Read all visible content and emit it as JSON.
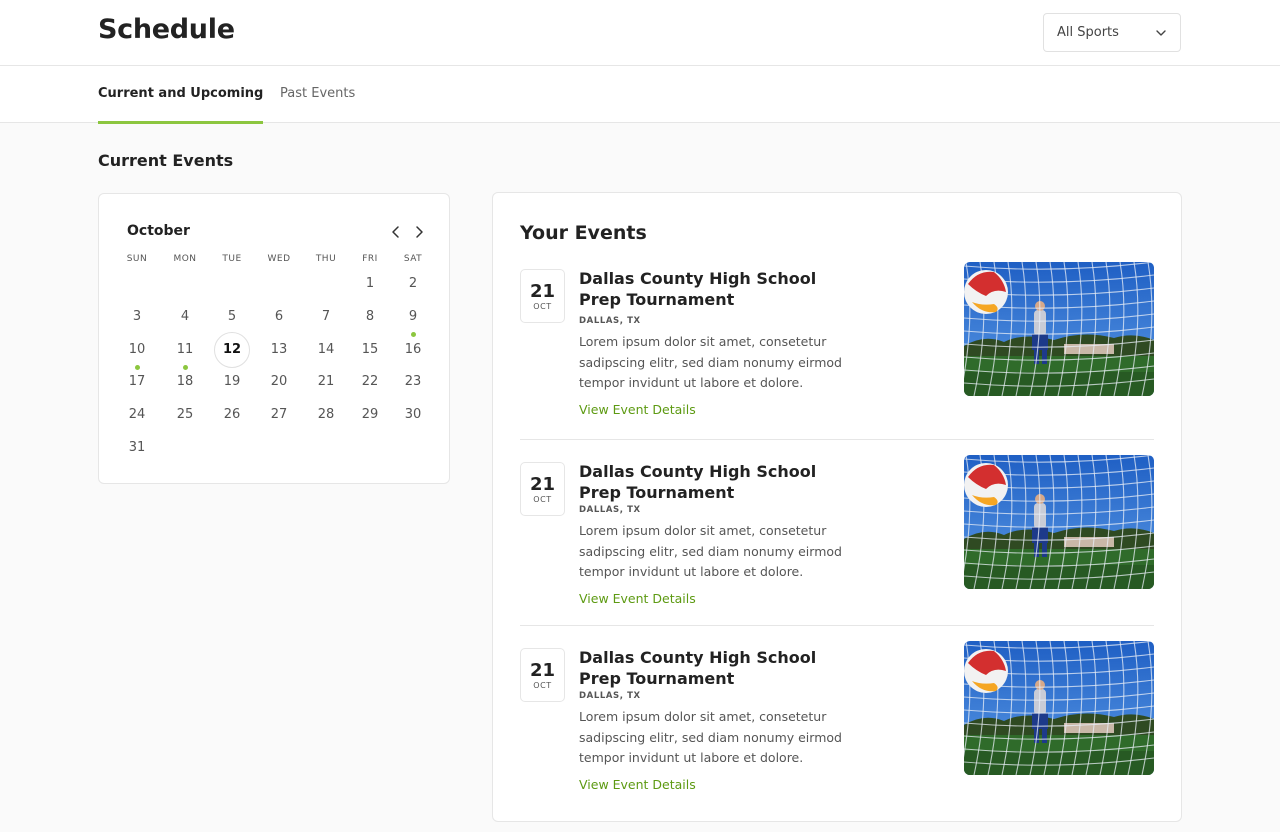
{
  "header": {
    "title": "Schedule",
    "sport_filter": {
      "selected": "All Sports"
    }
  },
  "tabs": [
    {
      "label": "Current and Upcoming",
      "active": true
    },
    {
      "label": "Past Events",
      "active": false
    }
  ],
  "section_title": "Current Events",
  "calendar": {
    "month": "October",
    "weekdays": [
      "SUN",
      "MON",
      "TUE",
      "WED",
      "THU",
      "FRI",
      "SAT"
    ],
    "days": [
      1,
      2,
      3,
      4,
      5,
      6,
      7,
      8,
      9,
      10,
      11,
      12,
      13,
      14,
      15,
      16,
      17,
      18,
      19,
      20,
      21,
      22,
      23,
      24,
      25,
      26,
      27,
      28,
      29,
      30,
      31
    ],
    "first_weekday_index": 5,
    "selected_day": 12,
    "event_days": [
      9,
      10,
      11
    ],
    "accent_color": "#8cc63f"
  },
  "events_panel": {
    "title": "Your Events",
    "events": [
      {
        "day": "21",
        "month": "OCT",
        "name": "Dallas County High School Prep Tournament",
        "location": "DALLAS, TX",
        "description": "Lorem ipsum dolor sit amet, consetetur sadipscing elitr, sed diam nonumy eirmod tempor invidunt ut labore et dolore.",
        "link_label": "View Event Details"
      },
      {
        "day": "21",
        "month": "OCT",
        "name": "Dallas County High School Prep Tournament",
        "location": "DALLAS, TX",
        "description": "Lorem ipsum dolor sit amet, consetetur sadipscing elitr, sed diam nonumy eirmod tempor invidunt ut labore et dolore.",
        "link_label": "View Event Details"
      },
      {
        "day": "21",
        "month": "OCT",
        "name": "Dallas County High School Prep Tournament",
        "location": "DALLAS, TX",
        "description": "Lorem ipsum dolor sit amet, consetetur sadipscing elitr, sed diam nonumy eirmod tempor invidunt ut labore et dolore.",
        "link_label": "View Event Details"
      }
    ]
  },
  "colors": {
    "accent": "#8cc63f",
    "link": "#5d9a12"
  }
}
